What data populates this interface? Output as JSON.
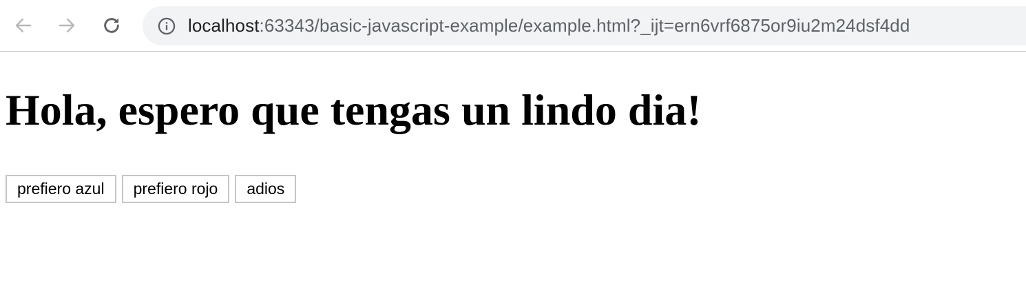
{
  "browser": {
    "address_bar": {
      "host": "localhost",
      "path": ":63343/basic-javascript-example/example.html?_ijt=ern6vrf6875or9iu2m24dsf4dd"
    },
    "icons": {
      "back": "arrow-left-icon",
      "forward": "arrow-right-icon",
      "reload": "reload-icon",
      "info": "info-circle-icon"
    },
    "colors": {
      "toolbar_bg": "#ffffff",
      "omnibox_bg": "#f1f3f4",
      "host_text": "#202124",
      "path_text": "#5f6368",
      "icon_disabled": "#b7b7b7",
      "icon_active": "#5f6368"
    }
  },
  "page": {
    "heading": "Hola, espero que tengas un lindo dia!",
    "buttons": [
      {
        "label": "prefiero azul"
      },
      {
        "label": "prefiero rojo"
      },
      {
        "label": "adios"
      }
    ]
  }
}
